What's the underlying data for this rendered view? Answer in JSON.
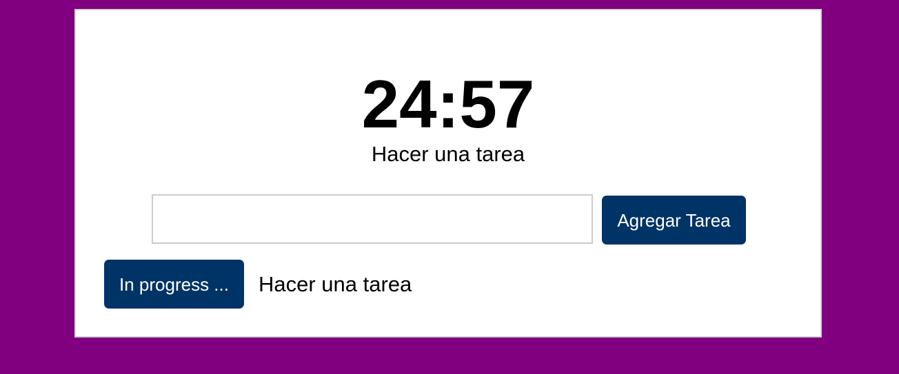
{
  "timer": {
    "display": "24:57",
    "current_task": "Hacer una tarea"
  },
  "form": {
    "input_value": "",
    "add_button_label": "Agregar Tarea"
  },
  "tasks": [
    {
      "status_label": "In progress ...",
      "name": "Hacer una tarea"
    }
  ],
  "colors": {
    "background": "#800080",
    "card": "#ffffff",
    "button": "#003366",
    "button_text": "#ffffff"
  }
}
